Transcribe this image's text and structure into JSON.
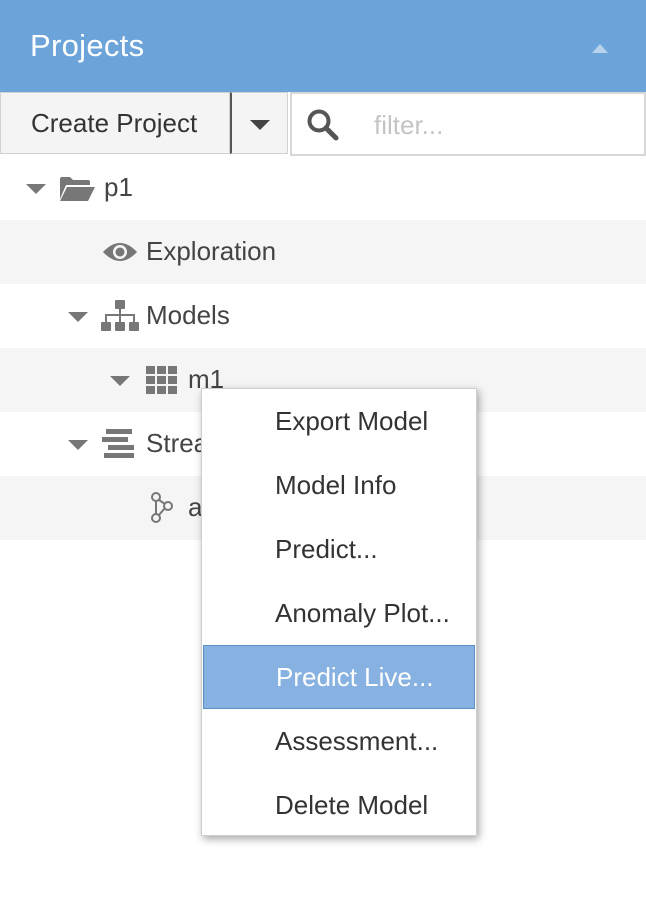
{
  "panel": {
    "title": "Projects"
  },
  "toolbar": {
    "create_label": "Create Project",
    "filter_placeholder": "filter..."
  },
  "tree": {
    "project": {
      "label": "p1"
    },
    "exploration": {
      "label": "Exploration"
    },
    "models": {
      "label": "Models"
    },
    "model_m1": {
      "label": "m1"
    },
    "streams": {
      "label": "Strea"
    },
    "stream_a": {
      "label": "a"
    }
  },
  "context_menu": {
    "items": [
      {
        "label": "Export Model"
      },
      {
        "label": "Model Info"
      },
      {
        "label": "Predict..."
      },
      {
        "label": "Anomaly Plot..."
      },
      {
        "label": "Predict Live..."
      },
      {
        "label": "Assessment..."
      },
      {
        "label": "Delete Model"
      }
    ],
    "highlighted_index": 4
  },
  "colors": {
    "header_bg": "#6ca3d8",
    "menu_highlight": "#86b1e0",
    "alt_row": "#f5f5f5",
    "icon_gray": "#777777"
  },
  "icons": [
    "chevron-up-icon",
    "chevron-down-icon",
    "search-icon",
    "folder-open-icon",
    "eye-icon",
    "sitemap-icon",
    "grid-icon",
    "stream-icon",
    "graph-icon"
  ]
}
